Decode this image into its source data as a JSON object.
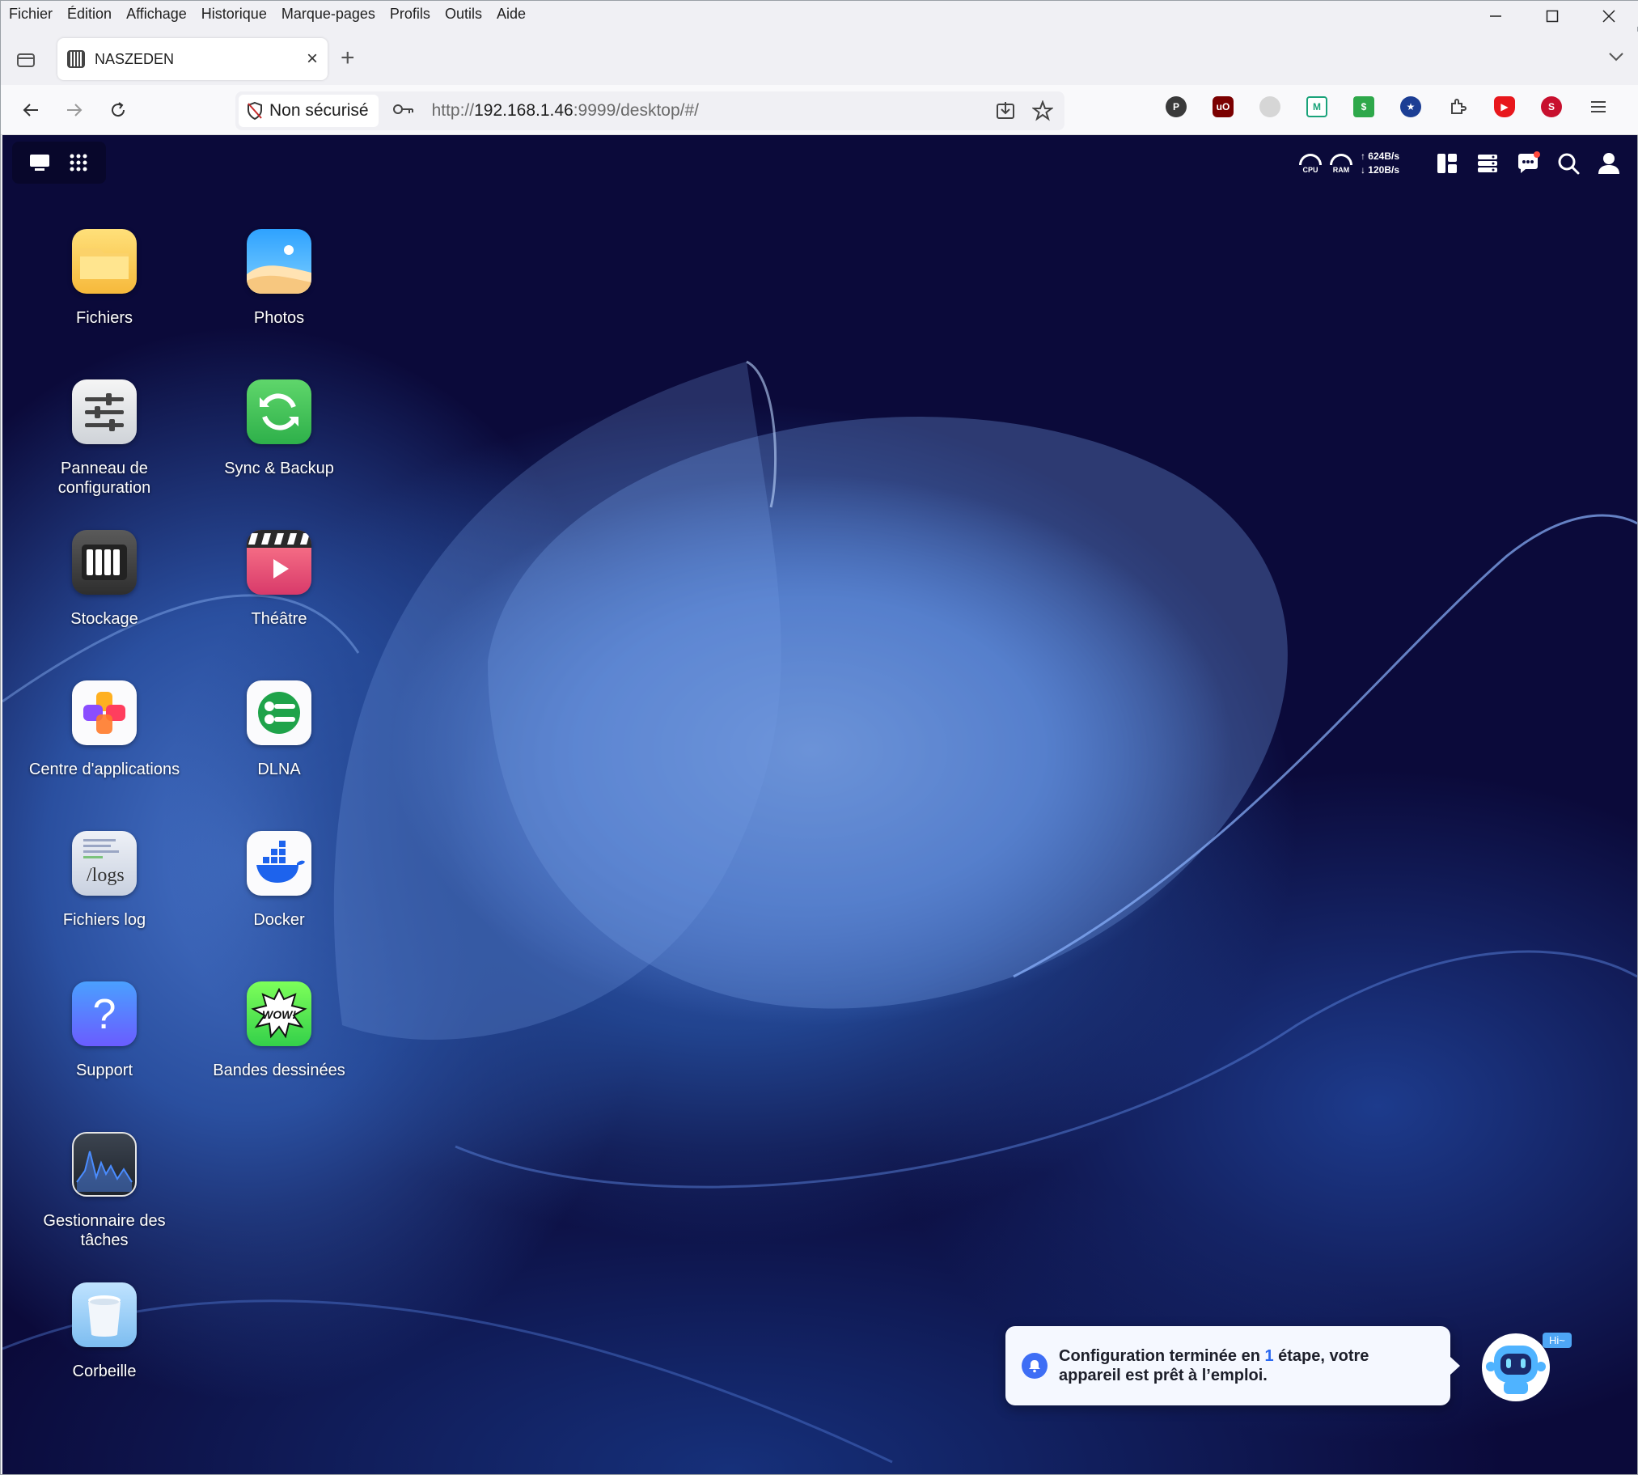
{
  "browser": {
    "menu": [
      "Fichier",
      "Édition",
      "Affichage",
      "Historique",
      "Marque-pages",
      "Profils",
      "Outils",
      "Aide"
    ],
    "tab_title": "NASZEDEN",
    "security_label": "Non sécurisé",
    "url_prefix": "http://",
    "url_host": "192.168.1.46",
    "url_rest": ":9999/desktop/#/",
    "extension_icons": [
      "proton-pass-icon",
      "ublock-icon",
      "extension-icon",
      "extension-icon",
      "extension-icon",
      "extension-icon",
      "puzzle-icon",
      "shield-icon",
      "extension-icon",
      "menu-icon"
    ]
  },
  "nas": {
    "topbar": {
      "cpu_label": "CPU",
      "ram_label": "RAM",
      "upload": "↑ 624B/s",
      "download": "↓ 120B/s"
    },
    "apps": [
      {
        "name": "Fichiers",
        "icon": "folder-icon"
      },
      {
        "name": "Photos",
        "icon": "photos-icon"
      },
      {
        "name": "Panneau de configuration",
        "icon": "settings-sliders-icon"
      },
      {
        "name": "Sync & Backup",
        "icon": "sync-icon"
      },
      {
        "name": "Stockage",
        "icon": "storage-icon"
      },
      {
        "name": "Théâtre",
        "icon": "clapper-icon"
      },
      {
        "name": "Centre d'applications",
        "icon": "app-center-icon"
      },
      {
        "name": "DLNA",
        "icon": "dlna-icon"
      },
      {
        "name": "Fichiers log",
        "icon": "logs-icon",
        "icon_text": "/logs"
      },
      {
        "name": "Docker",
        "icon": "docker-icon"
      },
      {
        "name": "Support",
        "icon": "help-icon",
        "icon_text": "?"
      },
      {
        "name": "Bandes dessinées",
        "icon": "comics-icon",
        "icon_text": "WOW!"
      },
      {
        "name": "Gestionnaire des tâches",
        "icon": "activity-icon"
      },
      {
        "name": "Corbeille",
        "icon": "trash-icon"
      }
    ],
    "notification": {
      "before": "Configuration terminée en ",
      "count": "1",
      "after": " étape, votre appareil est prêt à l’emploi."
    },
    "assistant_badge": "Hi~"
  }
}
